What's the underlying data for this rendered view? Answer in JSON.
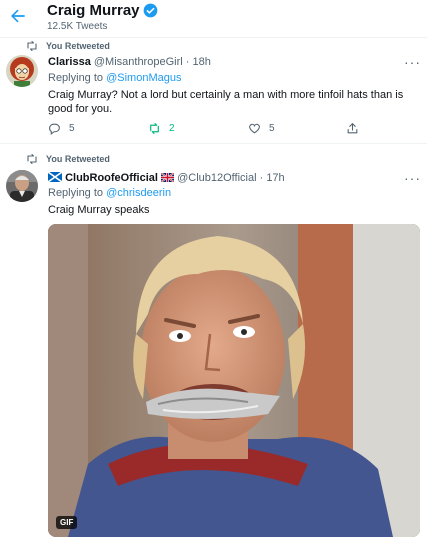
{
  "header": {
    "title": "Craig Murray",
    "subtitle": "12.5K Tweets"
  },
  "tweets": [
    {
      "retweet_label": "You Retweeted",
      "display_name": "Clarissa",
      "handle": "@MisanthropeGirl",
      "separator": " · ",
      "time": "18h",
      "reply_prefix": "Replying to ",
      "reply_to": "@SimonMagus",
      "text": "Craig Murray? Not a lord but certainly a man with more tinfoil hats than is good for you.",
      "replies": "5",
      "retweets": "2",
      "likes": "5"
    },
    {
      "retweet_label": "You Retweeted",
      "display_name": "ClubRoofeOfficial",
      "handle": "@Club12Official",
      "separator": " · ",
      "time": "17h",
      "reply_prefix": "Replying to ",
      "reply_to": "@chrisdeerin",
      "text": "Craig Murray speaks",
      "media_badge": "GIF"
    }
  ],
  "icons": {
    "back": "back-arrow-icon",
    "verified": "verified-badge-icon",
    "retweet": "retweet-icon",
    "more": "more-dots-icon",
    "reply": "reply-icon",
    "like": "heart-icon",
    "share": "share-icon"
  },
  "colors": {
    "accent": "#1d9bf0",
    "retweet_active": "#00ba7c",
    "secondary_text": "#536471"
  }
}
